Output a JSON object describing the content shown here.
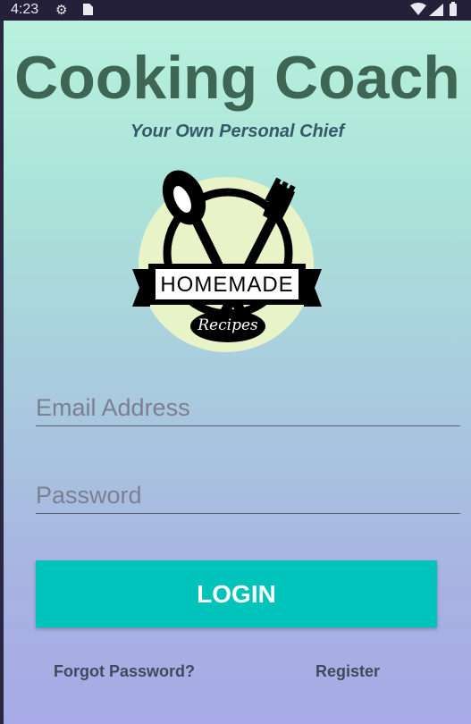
{
  "status_bar": {
    "time": "4:23",
    "icons": [
      "gear-icon",
      "sim-card-icon",
      "wifi-icon",
      "signal-icon",
      "battery-icon"
    ]
  },
  "app": {
    "title": "Cooking Coach",
    "subtitle": "Your Own Personal Chief",
    "logo": {
      "banner_text": "HOMEMADE",
      "script_text": "Recipes"
    }
  },
  "form": {
    "email_placeholder": "Email Address",
    "email_value": "",
    "password_placeholder": "Password",
    "password_value": "",
    "login_label": "LOGIN",
    "forgot_label": "Forgot Password?",
    "register_label": "Register"
  },
  "colors": {
    "title": "#3f6555",
    "subtitle": "#36586a",
    "login_button": "#00c4bb",
    "link": "#3f4a5e",
    "gradient_top": "#b9f1de",
    "gradient_bottom": "#a7aae6"
  }
}
